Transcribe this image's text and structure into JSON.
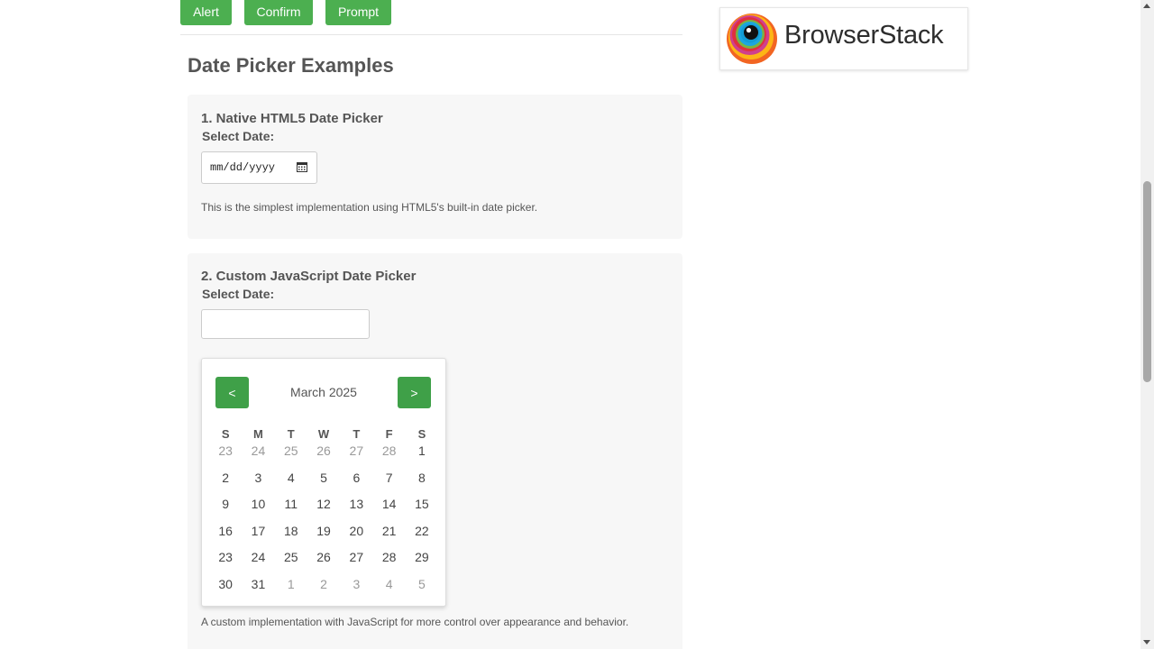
{
  "toolbar": {
    "alert_label": "Alert",
    "confirm_label": "Confirm",
    "prompt_label": "Prompt"
  },
  "sponsor": {
    "name": "BrowserStack",
    "icon": "browserstack-logo-icon"
  },
  "main": {
    "title": "Date Picker Examples",
    "native": {
      "heading": "1. Native HTML5 Date Picker",
      "label": "Select Date:",
      "placeholder": "mm/dd/yyyy",
      "icon": "calendar-icon",
      "description": "This is the simplest implementation using HTML5's built-in date picker."
    },
    "custom": {
      "heading": "2. Custom JavaScript Date Picker",
      "label": "Select Date:",
      "value": "",
      "description": "A custom implementation with JavaScript for more control over appearance and behavior.",
      "calendar": {
        "prev_label": "<",
        "next_label": ">",
        "month_label": "March 2025",
        "weekdays": [
          "S",
          "M",
          "T",
          "W",
          "T",
          "F",
          "S"
        ],
        "weeks": [
          [
            {
              "d": "23",
              "m": true
            },
            {
              "d": "24",
              "m": true
            },
            {
              "d": "25",
              "m": true
            },
            {
              "d": "26",
              "m": true
            },
            {
              "d": "27",
              "m": true
            },
            {
              "d": "28",
              "m": true
            },
            {
              "d": "1",
              "m": false
            }
          ],
          [
            {
              "d": "2",
              "m": false
            },
            {
              "d": "3",
              "m": false
            },
            {
              "d": "4",
              "m": false
            },
            {
              "d": "5",
              "m": false
            },
            {
              "d": "6",
              "m": false
            },
            {
              "d": "7",
              "m": false
            },
            {
              "d": "8",
              "m": false
            }
          ],
          [
            {
              "d": "9",
              "m": false
            },
            {
              "d": "10",
              "m": false
            },
            {
              "d": "11",
              "m": false
            },
            {
              "d": "12",
              "m": false
            },
            {
              "d": "13",
              "m": false
            },
            {
              "d": "14",
              "m": false
            },
            {
              "d": "15",
              "m": false
            }
          ],
          [
            {
              "d": "16",
              "m": false
            },
            {
              "d": "17",
              "m": false
            },
            {
              "d": "18",
              "m": false
            },
            {
              "d": "19",
              "m": false
            },
            {
              "d": "20",
              "m": false
            },
            {
              "d": "21",
              "m": false
            },
            {
              "d": "22",
              "m": false
            }
          ],
          [
            {
              "d": "23",
              "m": false
            },
            {
              "d": "24",
              "m": false
            },
            {
              "d": "25",
              "m": false
            },
            {
              "d": "26",
              "m": false
            },
            {
              "d": "27",
              "m": false
            },
            {
              "d": "28",
              "m": false
            },
            {
              "d": "29",
              "m": false
            }
          ],
          [
            {
              "d": "30",
              "m": false
            },
            {
              "d": "31",
              "m": false
            },
            {
              "d": "1",
              "m": true
            },
            {
              "d": "2",
              "m": true
            },
            {
              "d": "3",
              "m": true
            },
            {
              "d": "4",
              "m": true
            },
            {
              "d": "5",
              "m": true
            }
          ]
        ]
      }
    }
  },
  "colors": {
    "accent": "#4caf50",
    "nav_button": "#3fa048",
    "card_background": "#f7f7f7"
  }
}
